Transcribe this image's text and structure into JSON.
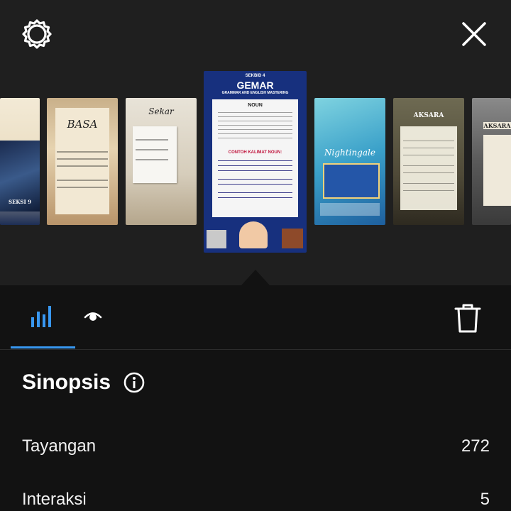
{
  "colors": {
    "accent": "#3897f0",
    "background_top": "#1f1f1f",
    "background_bottom": "#121212"
  },
  "icons": {
    "settings": "gear-icon",
    "close": "close-icon",
    "insights": "bar-chart-icon",
    "viewers": "eye-icon",
    "delete": "trash-icon",
    "info": "info-icon"
  },
  "stories": [
    {
      "label": "SEKSI 9",
      "selected": false
    },
    {
      "label": "BASA",
      "selected": false
    },
    {
      "label": "Sekar",
      "selected": false
    },
    {
      "header": "SEKBID 4",
      "title": "GEMAR",
      "subtitle": "GRAMMAR AND ENGLISH MASTERING",
      "section": "NOUN",
      "example_heading": "CONTOH KALIMAT NOUN:",
      "selected": true
    },
    {
      "label": "Nightingale",
      "selected": false
    },
    {
      "label": "AKSARA",
      "selected": false
    },
    {
      "label": "AKSARA",
      "selected": false
    }
  ],
  "summary": {
    "title": "Sinopsis",
    "rows": [
      {
        "label": "Tayangan",
        "value": "272"
      },
      {
        "label": "Interaksi",
        "value": "5"
      }
    ]
  }
}
